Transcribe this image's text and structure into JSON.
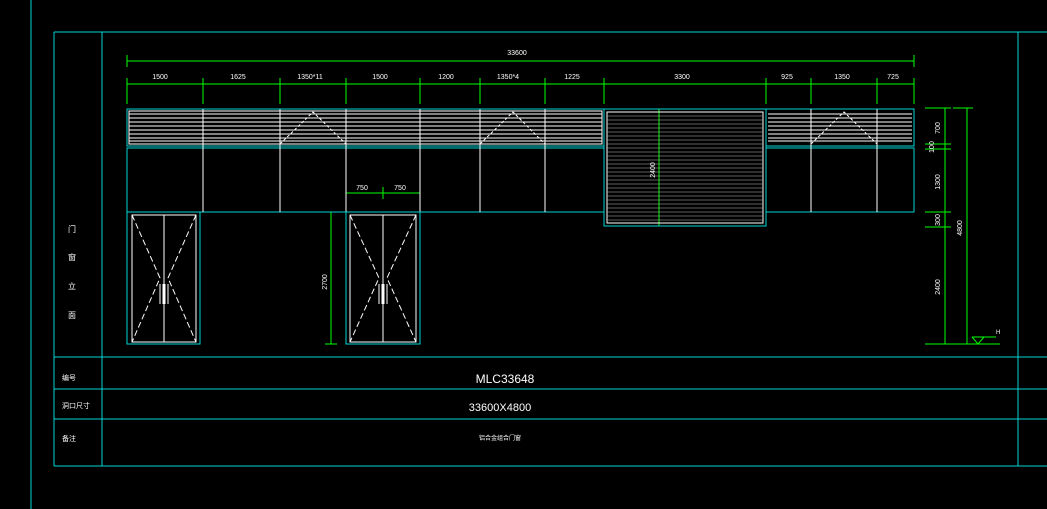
{
  "drawing": {
    "colors": {
      "background": "#000000",
      "frame": "#00d5d5",
      "dimension": "#00ff00",
      "geometry": "#ffffff"
    },
    "overall_width": "33600",
    "top_dims": [
      "1500",
      "1625",
      "1350*11",
      "1500",
      "1200",
      "1350*4",
      "1225",
      "3300",
      "925",
      "1350",
      "725"
    ],
    "door_dims": [
      "750",
      "750"
    ],
    "door_height": "2700",
    "shutter_height": "2400",
    "right_dims": [
      "700",
      "100",
      "1300",
      "300",
      "2400"
    ],
    "total_height": "4800",
    "level_mark": "H",
    "side_label_chars": [
      "门",
      "窗",
      "立",
      "面"
    ],
    "table": {
      "row1_label": "编号",
      "row1_value": "MLC33648",
      "row2_label": "洞口尺寸",
      "row2_value": "33600X4800",
      "row3_label": "备注",
      "row3_value": "铝合金组合门窗"
    }
  }
}
